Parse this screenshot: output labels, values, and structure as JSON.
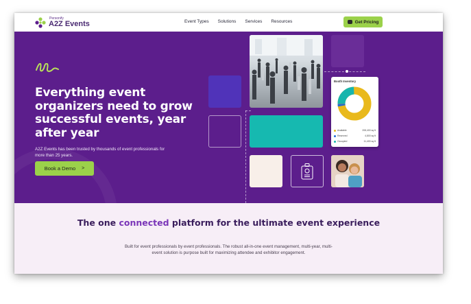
{
  "nav": {
    "logo_small": "Personify",
    "logo_main": "A2Z Events",
    "links": [
      "Event Types",
      "Solutions",
      "Services",
      "Resources"
    ],
    "pricing_label": "Get Pricing"
  },
  "hero": {
    "headline": "Everything event organizers need to grow successful events, year after year",
    "subtext": "A2Z Events has been trusted by thousands of event professionals for more than 25 years.",
    "demo_label": "Book a Demo",
    "demo_chevron": ">"
  },
  "booth_card": {
    "title": "Booth Inventory",
    "legend": [
      {
        "name": "Available",
        "value": "208,400 sq ft",
        "color": "#e9b91c"
      },
      {
        "name": "Reserved",
        "value": "4,800 sq ft",
        "color": "#1e6bd6"
      },
      {
        "name": "Occupied",
        "value": "11,400 sq ft",
        "color": "#17b5ad"
      }
    ]
  },
  "lower": {
    "title_pre": "The one ",
    "title_highlight": "connected",
    "title_post": " platform for the ultimate event experience",
    "body": "Built for event professionals by event professionals. The robust all-in-one event management, multi-year, multi-event solution is purpose built for maximizing attendee and exhibitor engagement."
  },
  "colors": {
    "hero_bg": "#5c1e8c",
    "accent_green": "#9bd14a",
    "teal": "#16b9b0",
    "lower_bg": "#f7eef7"
  }
}
